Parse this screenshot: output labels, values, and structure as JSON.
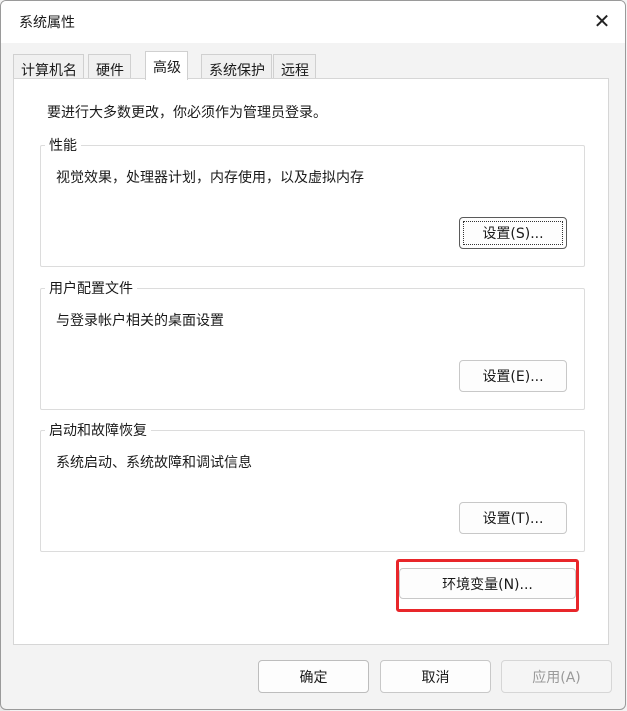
{
  "window": {
    "title": "系统属性"
  },
  "tabs": [
    {
      "label": "计算机名"
    },
    {
      "label": "硬件"
    },
    {
      "label": "高级",
      "active": true
    },
    {
      "label": "系统保护"
    },
    {
      "label": "远程"
    }
  ],
  "advanced": {
    "admin_note": "要进行大多数更改，你必须作为管理员登录。",
    "performance": {
      "title": "性能",
      "description": "视觉效果，处理器计划，内存使用，以及虚拟内存",
      "button": "设置(S)...",
      "button_underline": "S"
    },
    "user_profiles": {
      "title": "用户配置文件",
      "description": "与登录帐户相关的桌面设置",
      "button": "设置(E)...",
      "button_underline": "E"
    },
    "startup_recovery": {
      "title": "启动和故障恢复",
      "description": "系统启动、系统故障和调试信息",
      "button": "设置(T)...",
      "button_underline": "T"
    },
    "env_vars_button": "环境变量(N)...",
    "env_vars_underline": "N"
  },
  "footer": {
    "ok": "确定",
    "cancel": "取消",
    "apply": "应用(A)",
    "apply_disabled": true
  },
  "colors": {
    "highlight_box": "#e8262a",
    "panel_bg": "#ffffff",
    "window_bg": "#f3f3f3"
  }
}
